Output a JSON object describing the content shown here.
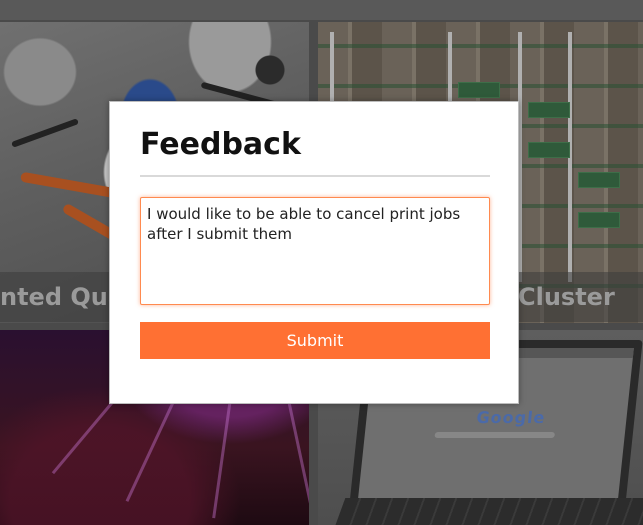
{
  "tiles": [
    {
      "caption": "nted Qua"
    },
    {
      "caption": "Cluster"
    },
    {
      "caption": ""
    },
    {
      "caption": ""
    }
  ],
  "laptop": {
    "logo_text": "Google"
  },
  "modal": {
    "title": "Feedback",
    "feedback_text": "I would like to be able to cancel print jobs after I submit them",
    "submit_label": "Submit"
  },
  "colors": {
    "accent": "#ff7033",
    "focus_border": "#ff8a4f",
    "overlay": "#4a4a4a"
  }
}
